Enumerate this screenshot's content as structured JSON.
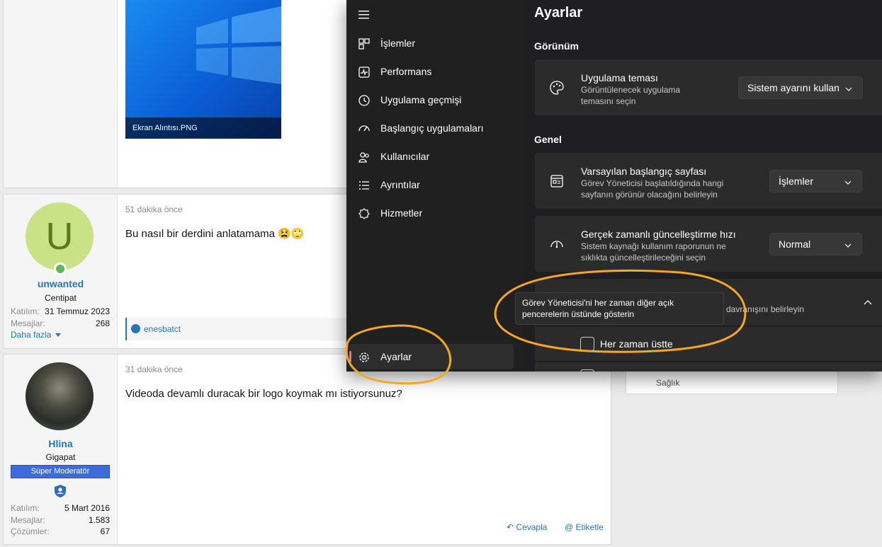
{
  "forum": {
    "image_caption": "Ekran Alıntısı.PNG",
    "post1": {
      "avatar_letter": "U",
      "username": "unwanted",
      "user_title": "Centipat",
      "stats": [
        {
          "label": "Katılım:",
          "value": "31 Temmuz 2023"
        },
        {
          "label": "Mesajlar:",
          "value": "268"
        }
      ],
      "more": "Daha fazla",
      "time": "51 dakika önce",
      "body": "Bu nasıl bir derdini anlatamama 😫🙄",
      "reaction_user": "enesbatct"
    },
    "post2": {
      "username": "Hlina",
      "user_title": "Gigapat",
      "badge": "Süper Moderatör",
      "stats": [
        {
          "label": "Katılım:",
          "value": "5 Mart 2016"
        },
        {
          "label": "Mesajlar:",
          "value": "1.583"
        },
        {
          "label": "Çözümler:",
          "value": "67"
        }
      ],
      "time": "31 dakika önce",
      "body": "Videoda devamlı duracak bir logo koymak mı istiyorsunuz?",
      "reply": "Cevapla",
      "mention": "@ Etiketle"
    },
    "side_panel_text": "Sağlık"
  },
  "taskmgr": {
    "nav_items": [
      {
        "label": "İşlemler",
        "icon": "processes-icon"
      },
      {
        "label": "Performans",
        "icon": "performance-icon"
      },
      {
        "label": "Uygulama geçmişi",
        "icon": "history-icon"
      },
      {
        "label": "Başlangıç uygulamaları",
        "icon": "startup-icon"
      },
      {
        "label": "Kullanıcılar",
        "icon": "users-icon"
      },
      {
        "label": "Ayrıntılar",
        "icon": "details-icon"
      },
      {
        "label": "Hizmetler",
        "icon": "services-icon"
      }
    ],
    "settings_nav": "Ayarlar",
    "page_title": "Ayarlar",
    "section_appearance": "Görünüm",
    "theme_title": "Uygulama teması",
    "theme_desc": "Görüntülenecek uygulama temasını seçin",
    "theme_value": "Sistem ayarını kullan",
    "section_general": "Genel",
    "startpage_title": "Varsayılan başlangıç sayfası",
    "startpage_desc": "Görev Yöneticisi başlatıldığında hangi sayfanın görünür olacağını belirleyin",
    "startpage_value": "İşlemler",
    "refresh_title": "Gerçek zamanlı güncelleştirme hızı",
    "refresh_desc": "Sistem kaynağı kullanım raporunun ne sıklıkta güncelleştirileceğini seçin",
    "refresh_value": "Normal",
    "window_desc_partial": "davranışını belirleyin",
    "tooltip": "Görev Yöneticisi'ni her zaman diğer açık pencerelerin üstünde gösterin",
    "always_on_top": "Her zaman üstte",
    "always_on_top_checked": false
  },
  "annotation_color": "#f5a623"
}
